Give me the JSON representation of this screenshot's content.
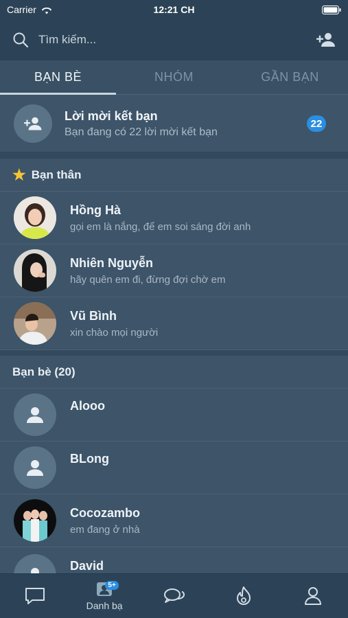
{
  "status_bar": {
    "carrier": "Carrier",
    "time": "12:21 CH"
  },
  "search": {
    "placeholder": "Tìm kiếm..."
  },
  "tabs": [
    {
      "label": "BẠN BÈ",
      "active": true
    },
    {
      "label": "NHÓM",
      "active": false
    },
    {
      "label": "GẦN BẠN",
      "active": false
    }
  ],
  "friend_request": {
    "title": "Lời mời kết bạn",
    "subtitle": "Bạn đang có 22 lời mời kết bạn",
    "count": "22"
  },
  "close_friends": {
    "header": "Bạn thân",
    "items": [
      {
        "name": "Hồng Hà",
        "status": "gọi em là nắng, để em soi sáng đời anh"
      },
      {
        "name": "Nhiên Nguyễn",
        "status": "hãy quên em đi, đừng đợi chờ em"
      },
      {
        "name": "Vũ Bình",
        "status": "xin chào mọi người"
      }
    ]
  },
  "friends": {
    "header": "Bạn bè (20)",
    "items": [
      {
        "name": "Alooo",
        "status": ""
      },
      {
        "name": "BLong",
        "status": ""
      },
      {
        "name": "Cocozambo",
        "status": "em đang ở nhà"
      },
      {
        "name": "David",
        "status": ""
      }
    ]
  },
  "tab_bar": {
    "items": [
      {
        "icon": "chat-icon",
        "label": ""
      },
      {
        "icon": "contacts-icon",
        "label": "Danh bạ",
        "badge": "5+"
      },
      {
        "icon": "conversations-icon",
        "label": ""
      },
      {
        "icon": "fire-icon",
        "label": ""
      },
      {
        "icon": "profile-icon",
        "label": ""
      }
    ]
  },
  "colors": {
    "accent": "#2b8ee0",
    "star": "#f6c531",
    "background": "#3d5469",
    "header": "#2c4357"
  }
}
